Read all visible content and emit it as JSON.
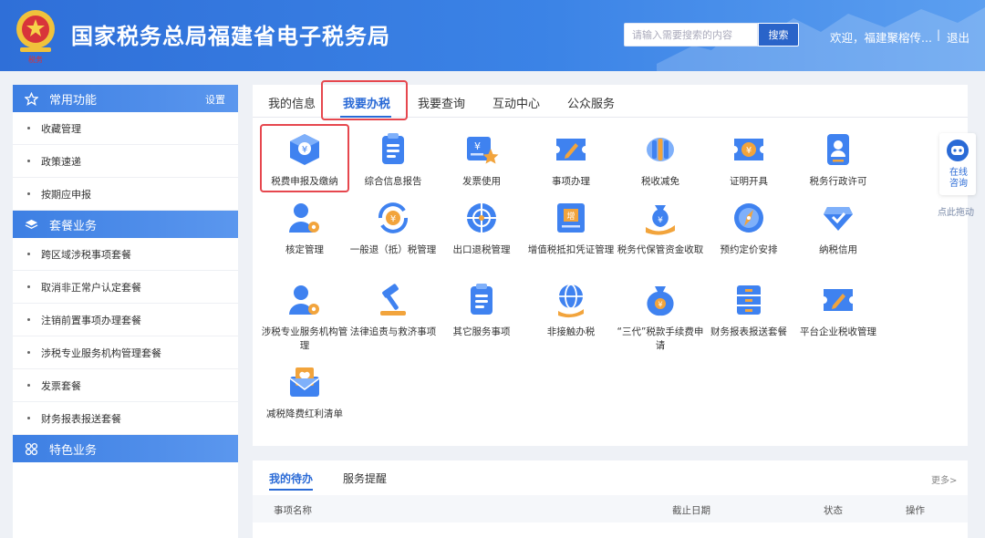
{
  "header": {
    "title": "国家税务总局福建省电子税务局",
    "search_placeholder": "请输入需要搜索的内容",
    "search_button": "搜索",
    "welcome": "欢迎，福建聚榕传...",
    "separator": "|",
    "logout": "退出"
  },
  "sidebar": {
    "sections": [
      {
        "title": "常用功能",
        "action": "设置",
        "icon": "star-icon",
        "items": [
          "收藏管理",
          "政策速递",
          "按期应申报"
        ]
      },
      {
        "title": "套餐业务",
        "icon": "layers-icon",
        "items": [
          "跨区域涉税事项套餐",
          "取消非正常户认定套餐",
          "注销前置事项办理套餐",
          "涉税专业服务机构管理套餐",
          "发票套餐",
          "财务报表报送套餐"
        ]
      },
      {
        "title": "特色业务",
        "icon": "grid-icon",
        "items": []
      }
    ]
  },
  "tabs": [
    "我的信息",
    "我要办税",
    "我要查询",
    "互动中心",
    "公众服务"
  ],
  "active_tab": "我要办税",
  "services": [
    {
      "label": "税费申报及缴纳",
      "icon": "tax-box-icon"
    },
    {
      "label": "综合信息报告",
      "icon": "clipboard-icon"
    },
    {
      "label": "发票使用",
      "icon": "invoice-star-icon"
    },
    {
      "label": "事项办理",
      "icon": "edit-ticket-icon"
    },
    {
      "label": "税收减免",
      "icon": "coin-stack-icon"
    },
    {
      "label": "证明开具",
      "icon": "certificate-icon"
    },
    {
      "label": "税务行政许可",
      "icon": "id-card-icon"
    },
    {
      "label": "核定管理",
      "icon": "user-gear-icon"
    },
    {
      "label": "一般退（抵）税管理",
      "icon": "refund-cycle-icon"
    },
    {
      "label": "出口退税管理",
      "icon": "globe-icon"
    },
    {
      "label": "增值税抵扣凭证管理",
      "icon": "vat-ticket-icon"
    },
    {
      "label": "税务代保管资金收取",
      "icon": "money-bag-hand-icon"
    },
    {
      "label": "预约定价安排",
      "icon": "compass-icon"
    },
    {
      "label": "纳税信用",
      "icon": "shield-check-icon"
    },
    {
      "label": "涉税专业服务机构管理",
      "icon": "user-gear-icon"
    },
    {
      "label": "法律追责与救济事项",
      "icon": "gavel-icon"
    },
    {
      "label": "其它服务事项",
      "icon": "clipboard-icon"
    },
    {
      "label": "非接触办税",
      "icon": "globe-hand-icon"
    },
    {
      "label": "“三代”税款手续费申请",
      "icon": "money-bag-icon"
    },
    {
      "label": "财务报表报送套餐",
      "icon": "cabinet-icon"
    },
    {
      "label": "平台企业税收管理",
      "icon": "edit-ticket-icon"
    },
    {
      "label": "减税降费红利清单",
      "icon": "envelope-heart-icon"
    }
  ],
  "float_widget": {
    "label": "在线咨询",
    "drag_hint": "点此拖动"
  },
  "todo": {
    "tabs": [
      "我的待办",
      "服务提醒"
    ],
    "more": "更多>",
    "columns": [
      "事项名称",
      "截止日期",
      "状态",
      "操作"
    ]
  },
  "colors": {
    "primary": "#2a6ad6",
    "header": "#3b83e6",
    "highlight": "#e6474e",
    "icon_blue": "#3f82f0",
    "icon_orange": "#f2a43c"
  }
}
